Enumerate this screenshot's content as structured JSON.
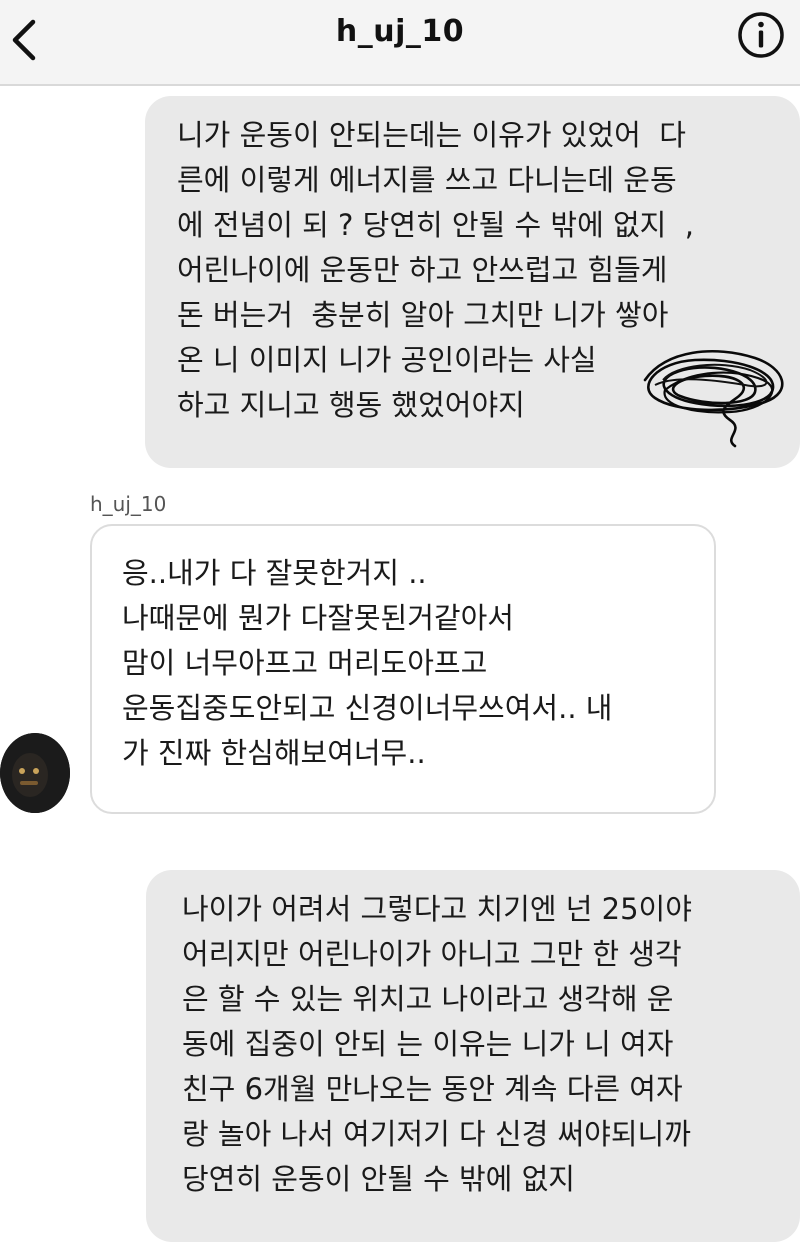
{
  "header": {
    "title": "h_uj_10",
    "back_icon": "chevron-left-icon",
    "info_icon": "info-circle-icon"
  },
  "messages": [
    {
      "direction": "sent",
      "text": "니가 운동이 안되는데는 이유가 있었어  다\n른에 이렇게 에너지를 쓰고 다니는데 운동\n에 전념이 되 ? 당연히 안될 수 밖에 없지  ,\n어린나이에 운동만 하고 안쓰럽고 힘들게\n돈 버는거  충분히 알아 그치만 니가 쌓아\n온 니 이미지 니가 공인이라는 사실\n하고 지니고 행동 했었어야지"
    },
    {
      "direction": "received",
      "sender": "h_uj_10",
      "text": "응..내가 다 잘못한거지 ..\n나때문에 뭔가 다잘못된거같아서\n맘이 너무아프고 머리도아프고\n운동집중도안되고 신경이너무쓰여서.. 내\n가 진짜 한심해보여너무.."
    },
    {
      "direction": "sent",
      "text": "나이가 어려서 그렇다고 치기엔 넌 25이야\n어리지만 어린나이가 아니고 그만 한 생각\n은 할 수 있는 위치고 나이라고 생각해 운\n동에 집중이 안되 는 이유는 니가 니 여자\n친구 6개월 만나오는 동안 계속 다른 여자\n랑 놀아 나서 여기저기 다 신경 써야되니까\n당연히 운동이 안될 수 밖에 없지"
    }
  ],
  "colors": {
    "sent_bubble": "#e9e9e9",
    "received_bubble_border": "#dcdcdc",
    "header_bg": "#f4f4f4"
  }
}
